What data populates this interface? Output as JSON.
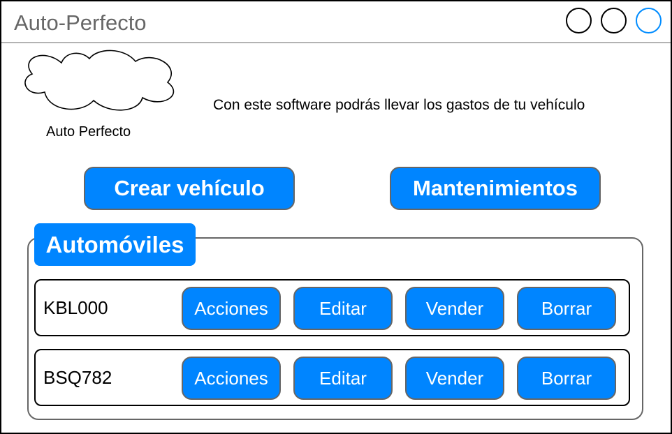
{
  "window": {
    "title": "Auto-Perfecto",
    "controls": [
      "minimize",
      "maximize",
      "close"
    ]
  },
  "header": {
    "logo_label": "Auto Perfecto",
    "tagline": "Con este software podrás llevar los gastos de tu vehículo"
  },
  "actions": {
    "create_label": "Crear vehículo",
    "maintenance_label": "Mantenimientos"
  },
  "vehicles": {
    "title": "Automóviles",
    "rows": [
      {
        "plate": "KBL000",
        "actions_label": "Acciones",
        "edit_label": "Editar",
        "sell_label": "Vender",
        "delete_label": "Borrar"
      },
      {
        "plate": "BSQ782",
        "actions_label": "Acciones",
        "edit_label": "Editar",
        "sell_label": "Vender",
        "delete_label": "Borrar"
      }
    ]
  },
  "colors": {
    "accent": "#0085ff",
    "border": "#666666",
    "title_text": "#666666"
  }
}
